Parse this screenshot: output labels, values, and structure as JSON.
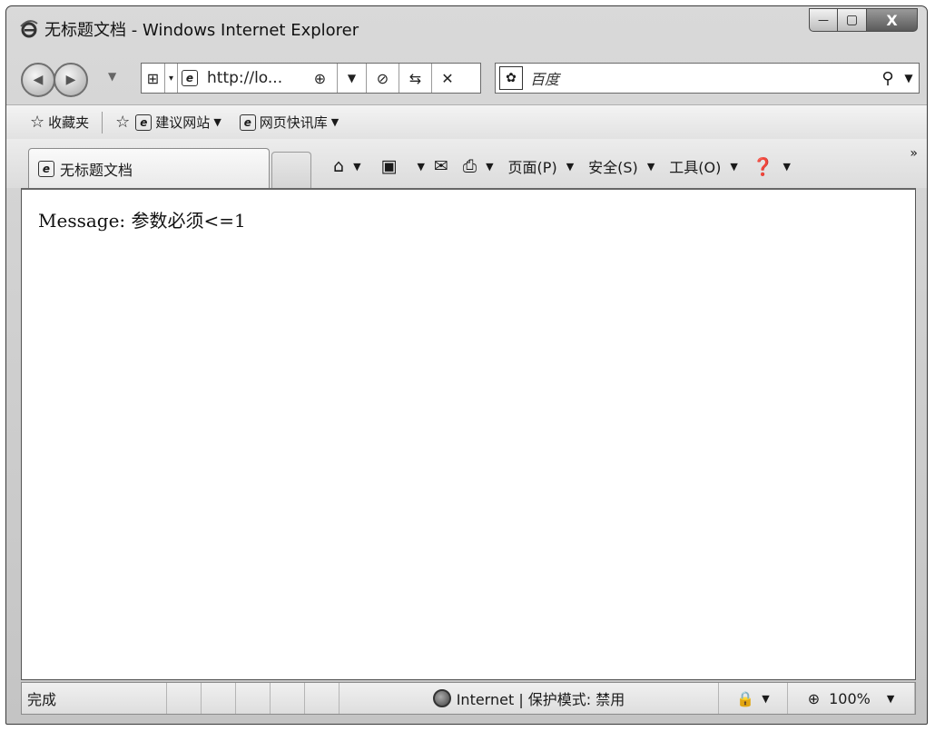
{
  "window": {
    "title": "无标题文档 - Windows Internet Explorer",
    "controls": {
      "minimize": "—",
      "maximize": "▢",
      "close": "X"
    }
  },
  "address_bar": {
    "back_icon": "◀",
    "forward_icon": "▶",
    "url": "http://lo...",
    "search_placeholder": "百度"
  },
  "favorites_bar": {
    "favorites_label": "收藏夹",
    "items": [
      "建议网站",
      "网页快讯库"
    ]
  },
  "tabs": [
    {
      "label": "无标题文档",
      "active": true
    }
  ],
  "command_bar": {
    "page_menu": "页面(P)",
    "safety_menu": "安全(S)",
    "tools_menu": "工具(O)"
  },
  "content": {
    "message": "Message: 参数必须<=1"
  },
  "status_bar": {
    "status": "完成",
    "zone": "Internet | 保护模式: 禁用",
    "zoom": "100%"
  }
}
